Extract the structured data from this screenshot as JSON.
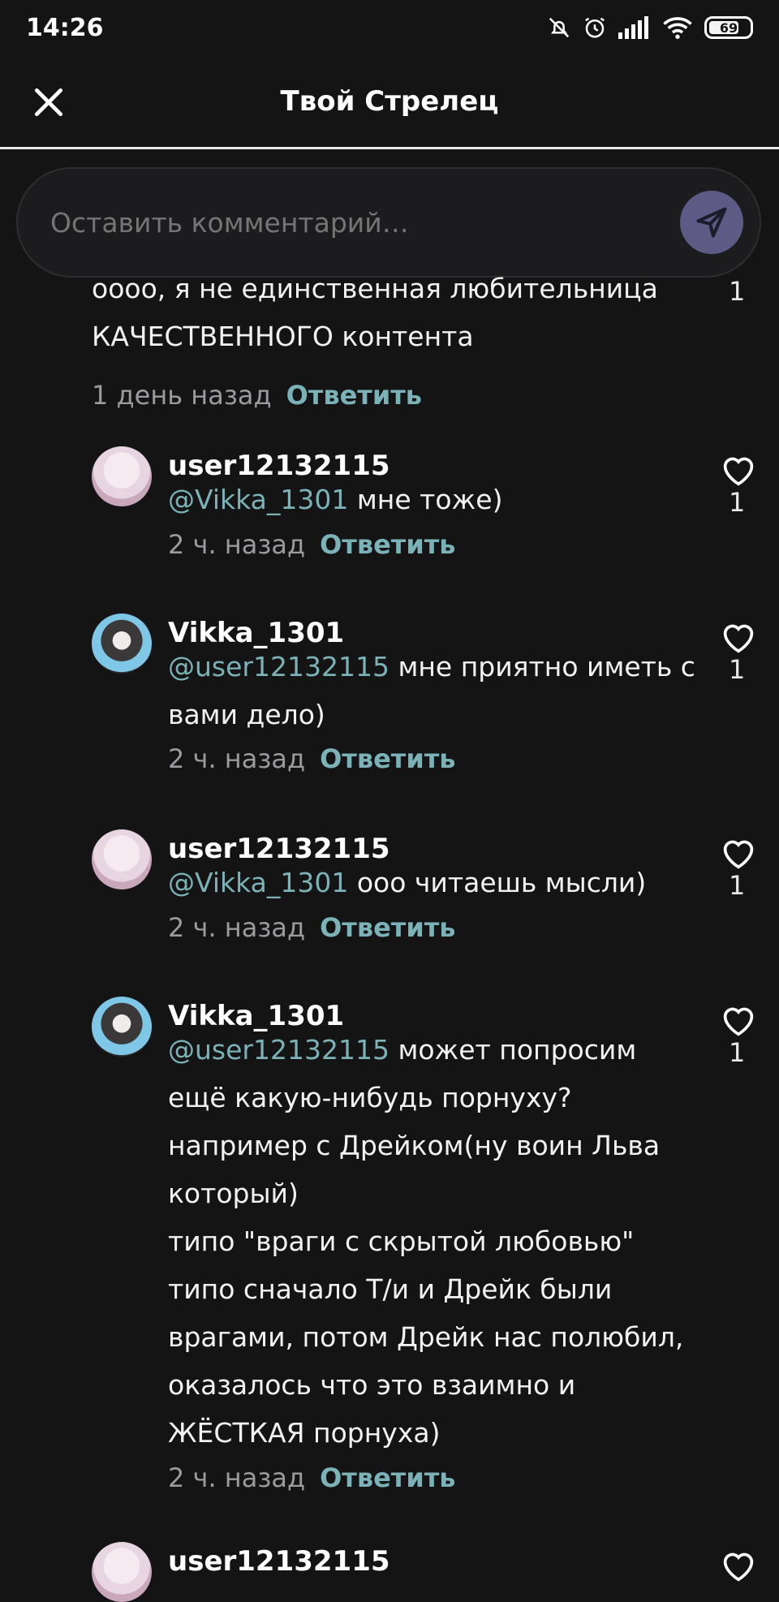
{
  "status": {
    "time": "14:26",
    "battery": "69"
  },
  "header": {
    "title": "Твой Стрелец"
  },
  "composer": {
    "placeholder": "Оставить комментарий…"
  },
  "reply_label": "Ответить",
  "comments": [
    {
      "user": "",
      "mention": "",
      "text": "оооо, я не единственная любительница\nКАЧЕСТВЕННОГО контента",
      "time": "1 день назад",
      "likes": "1"
    },
    {
      "user": "user12132115",
      "mention": "@Vikka_1301",
      "text": " мне тоже)",
      "time": "2 ч. назад",
      "likes": "1"
    },
    {
      "user": "Vikka_1301",
      "mention": "@user12132115",
      "text": " мне приятно иметь с\nвами дело)",
      "time": "2 ч. назад",
      "likes": "1"
    },
    {
      "user": "user12132115",
      "mention": "@Vikka_1301",
      "text": " ооо читаешь мысли)",
      "time": "2 ч. назад",
      "likes": "1"
    },
    {
      "user": "Vikka_1301",
      "mention": "@user12132115",
      "text": " может попросим\nещё какую-нибудь порнуху?\nнапример с Дрейком(ну воин Льва\nкоторый)\nтипо \"враги с скрытой любовью\"\nтипо сначало Т/и и Дрейк были\nврагами, потом Дрейк нас полюбил,\nоказалось что это взаимно и\nЖЁСТКАЯ порнуха)",
      "time": "2 ч. назад",
      "likes": "1"
    },
    {
      "user": "user12132115",
      "mention": "",
      "text": "",
      "time": "",
      "likes": ""
    }
  ]
}
